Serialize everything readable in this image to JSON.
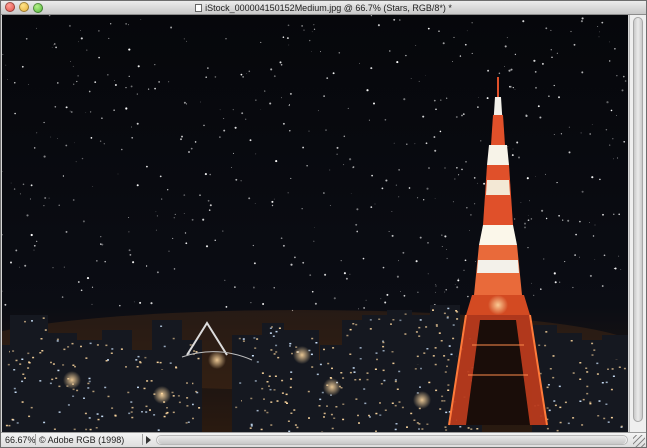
{
  "window": {
    "title": "iStock_000004150152Medium.jpg @ 66.7% (Stars, RGB/8*) *"
  },
  "statusbar": {
    "zoom": "66.67%",
    "profile": "Adobe RGB (1998) (8bpc)"
  },
  "colors": {
    "sky": "#07080d",
    "tower_red": "#e0502a",
    "tower_white": "#f3f1ea",
    "city_light": "#ffd9a0"
  },
  "icons": [
    "close-button",
    "minimize-button",
    "zoom-button",
    "document-icon",
    "right-arrow-icon",
    "resize-grip-icon"
  ]
}
